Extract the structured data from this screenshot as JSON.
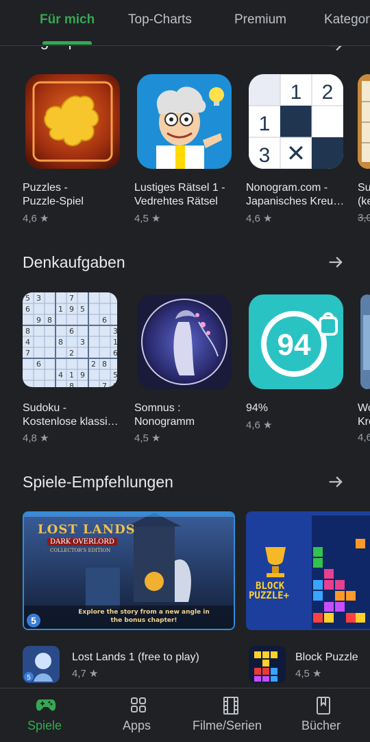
{
  "tabs": {
    "items": [
      "Für mich",
      "Top-Charts",
      "Premium",
      "Kategorien"
    ],
    "active": "Für mich"
  },
  "sections": {
    "logic": {
      "title": "Logikspiele",
      "apps": [
        {
          "name": "Puzzles -\nPuzzle-Spiel",
          "rating": "4,6 ★"
        },
        {
          "name": "Lustiges Rätsel 1 -\nVedrehtes Rätsel",
          "rating": "4,5 ★"
        },
        {
          "name": "Nonogram.com -\nJapanisches Kreu…",
          "rating": "4,6 ★"
        },
        {
          "name": "Su\n(ke",
          "rating": "3,0"
        }
      ]
    },
    "brain": {
      "title": "Denkaufgaben",
      "apps": [
        {
          "name": "Sudoku -\nKostenlose klassi…",
          "rating": "4,8 ★"
        },
        {
          "name": "Somnus :\nNonogramm",
          "rating": "4,5 ★"
        },
        {
          "name": "94%",
          "rating": "4,6 ★"
        },
        {
          "name": "Wo\nKre",
          "rating": "4,6"
        }
      ]
    },
    "recommend": {
      "title": "Spiele-Empfehlungen",
      "cards": [
        {
          "name": "Lost Lands 1 (free to play)",
          "rating": "4,7 ★",
          "banner_title": "LOST LANDS",
          "banner_subtitle": "DARK OVERLORD",
          "banner_edition": "COLLECTOR'S EDITION",
          "banner_caption": "Explore the story from a new angle in the bonus chapter!",
          "badge": "5"
        },
        {
          "name": "Block Puzzle",
          "rating": "4,5 ★",
          "banner_title": "BLOCK",
          "banner_subtitle": "PUZZLE+"
        }
      ]
    }
  },
  "nonogram_icon": {
    "top": [
      "1",
      "2"
    ],
    "side": [
      "1",
      "3"
    ],
    "mark": "✕"
  },
  "ninety_four_icon": {
    "number": "94"
  },
  "bottom_nav": {
    "items": [
      {
        "label": "Spiele",
        "active": true
      },
      {
        "label": "Apps",
        "active": false
      },
      {
        "label": "Filme/Serien",
        "active": false
      },
      {
        "label": "Bücher",
        "active": false
      }
    ]
  },
  "colors": {
    "accent": "#34a853",
    "background": "#202124",
    "text": "#e8eaed",
    "muted": "#9aa0a6"
  }
}
